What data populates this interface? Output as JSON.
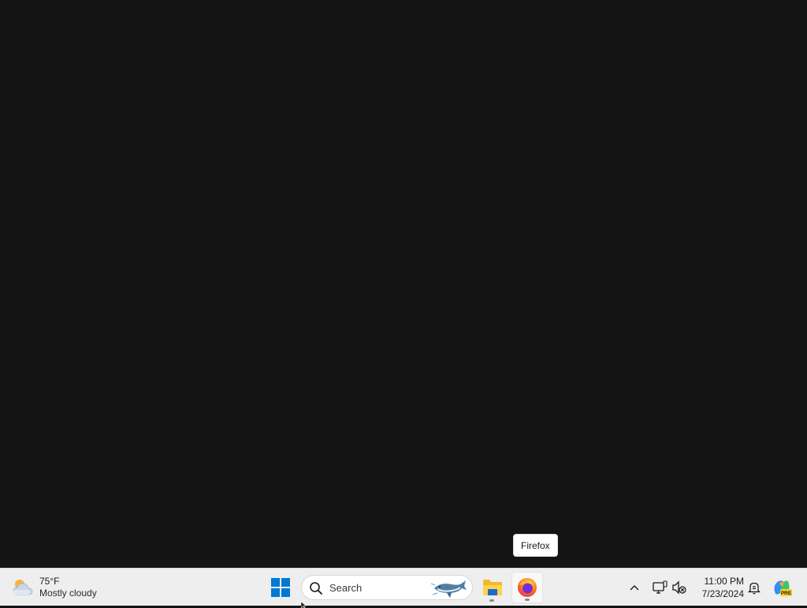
{
  "tooltip": {
    "text": "Firefox"
  },
  "taskbar": {
    "weather": {
      "temp": "75°F",
      "condition": "Mostly cloudy",
      "icon": "cloudy-weather-icon"
    },
    "start": {
      "icon": "windows-start-icon"
    },
    "search": {
      "placeholder": "Search",
      "icon": "search-icon",
      "highlight_icon": "whale-search-highlight-icon"
    },
    "apps": [
      {
        "name": "File Explorer",
        "icon": "folder-icon"
      },
      {
        "name": "Firefox",
        "icon": "firefox-icon"
      }
    ],
    "tray": {
      "chevron_icon": "chevron-up-icon",
      "network_icon": "network-icon",
      "sound_icon": "speaker-muted-icon",
      "clock": {
        "time": "11:00 PM",
        "date": "7/23/2024"
      },
      "notifications_icon": "notification-bell-icon",
      "copilot_icon": "copilot-icon",
      "copilot_badge": "PRE"
    }
  },
  "colors": {
    "desktop_bg": "#141414",
    "taskbar_bg": "#eeeeee",
    "start_blue": "#0078d4"
  }
}
